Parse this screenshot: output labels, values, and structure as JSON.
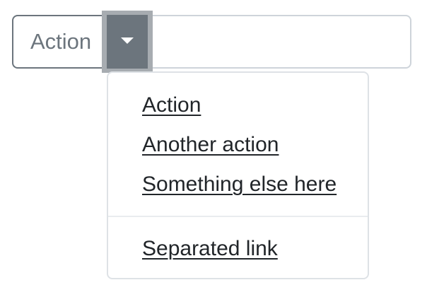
{
  "button_group": {
    "action_label": "Action",
    "toggle_icon": "caret-down-icon"
  },
  "dropdown": {
    "items": [
      {
        "label": "Action"
      },
      {
        "label": "Another action"
      },
      {
        "label": "Something else here"
      }
    ],
    "separated_items": [
      {
        "label": "Separated link"
      }
    ]
  },
  "colors": {
    "secondary": "#6c757d",
    "border": "#ced4da",
    "text": "#212529"
  }
}
